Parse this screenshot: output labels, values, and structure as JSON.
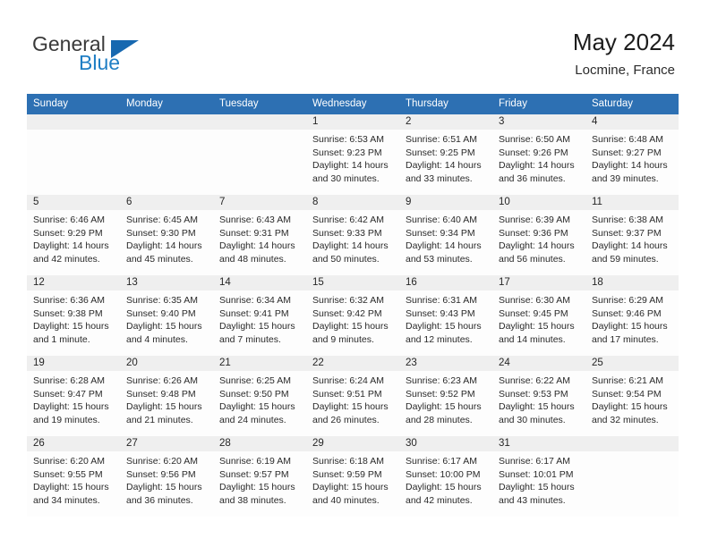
{
  "brand": {
    "name_part1": "General",
    "name_part2": "Blue"
  },
  "header": {
    "title": "May 2024",
    "location": "Locmine, France"
  },
  "colors": {
    "header_blue": "#2d70b3",
    "brand_blue": "#1f7ec4",
    "daynum_band": "#efefef",
    "text": "#2a2a2a"
  },
  "calendar": {
    "weekday_headers": [
      "Sunday",
      "Monday",
      "Tuesday",
      "Wednesday",
      "Thursday",
      "Friday",
      "Saturday"
    ],
    "weeks": [
      [
        {
          "day": "",
          "sunrise": "",
          "sunset": "",
          "daylight_1": "",
          "daylight_2": ""
        },
        {
          "day": "",
          "sunrise": "",
          "sunset": "",
          "daylight_1": "",
          "daylight_2": ""
        },
        {
          "day": "",
          "sunrise": "",
          "sunset": "",
          "daylight_1": "",
          "daylight_2": ""
        },
        {
          "day": "1",
          "sunrise": "Sunrise: 6:53 AM",
          "sunset": "Sunset: 9:23 PM",
          "daylight_1": "Daylight: 14 hours",
          "daylight_2": "and 30 minutes."
        },
        {
          "day": "2",
          "sunrise": "Sunrise: 6:51 AM",
          "sunset": "Sunset: 9:25 PM",
          "daylight_1": "Daylight: 14 hours",
          "daylight_2": "and 33 minutes."
        },
        {
          "day": "3",
          "sunrise": "Sunrise: 6:50 AM",
          "sunset": "Sunset: 9:26 PM",
          "daylight_1": "Daylight: 14 hours",
          "daylight_2": "and 36 minutes."
        },
        {
          "day": "4",
          "sunrise": "Sunrise: 6:48 AM",
          "sunset": "Sunset: 9:27 PM",
          "daylight_1": "Daylight: 14 hours",
          "daylight_2": "and 39 minutes."
        }
      ],
      [
        {
          "day": "5",
          "sunrise": "Sunrise: 6:46 AM",
          "sunset": "Sunset: 9:29 PM",
          "daylight_1": "Daylight: 14 hours",
          "daylight_2": "and 42 minutes."
        },
        {
          "day": "6",
          "sunrise": "Sunrise: 6:45 AM",
          "sunset": "Sunset: 9:30 PM",
          "daylight_1": "Daylight: 14 hours",
          "daylight_2": "and 45 minutes."
        },
        {
          "day": "7",
          "sunrise": "Sunrise: 6:43 AM",
          "sunset": "Sunset: 9:31 PM",
          "daylight_1": "Daylight: 14 hours",
          "daylight_2": "and 48 minutes."
        },
        {
          "day": "8",
          "sunrise": "Sunrise: 6:42 AM",
          "sunset": "Sunset: 9:33 PM",
          "daylight_1": "Daylight: 14 hours",
          "daylight_2": "and 50 minutes."
        },
        {
          "day": "9",
          "sunrise": "Sunrise: 6:40 AM",
          "sunset": "Sunset: 9:34 PM",
          "daylight_1": "Daylight: 14 hours",
          "daylight_2": "and 53 minutes."
        },
        {
          "day": "10",
          "sunrise": "Sunrise: 6:39 AM",
          "sunset": "Sunset: 9:36 PM",
          "daylight_1": "Daylight: 14 hours",
          "daylight_2": "and 56 minutes."
        },
        {
          "day": "11",
          "sunrise": "Sunrise: 6:38 AM",
          "sunset": "Sunset: 9:37 PM",
          "daylight_1": "Daylight: 14 hours",
          "daylight_2": "and 59 minutes."
        }
      ],
      [
        {
          "day": "12",
          "sunrise": "Sunrise: 6:36 AM",
          "sunset": "Sunset: 9:38 PM",
          "daylight_1": "Daylight: 15 hours",
          "daylight_2": "and 1 minute."
        },
        {
          "day": "13",
          "sunrise": "Sunrise: 6:35 AM",
          "sunset": "Sunset: 9:40 PM",
          "daylight_1": "Daylight: 15 hours",
          "daylight_2": "and 4 minutes."
        },
        {
          "day": "14",
          "sunrise": "Sunrise: 6:34 AM",
          "sunset": "Sunset: 9:41 PM",
          "daylight_1": "Daylight: 15 hours",
          "daylight_2": "and 7 minutes."
        },
        {
          "day": "15",
          "sunrise": "Sunrise: 6:32 AM",
          "sunset": "Sunset: 9:42 PM",
          "daylight_1": "Daylight: 15 hours",
          "daylight_2": "and 9 minutes."
        },
        {
          "day": "16",
          "sunrise": "Sunrise: 6:31 AM",
          "sunset": "Sunset: 9:43 PM",
          "daylight_1": "Daylight: 15 hours",
          "daylight_2": "and 12 minutes."
        },
        {
          "day": "17",
          "sunrise": "Sunrise: 6:30 AM",
          "sunset": "Sunset: 9:45 PM",
          "daylight_1": "Daylight: 15 hours",
          "daylight_2": "and 14 minutes."
        },
        {
          "day": "18",
          "sunrise": "Sunrise: 6:29 AM",
          "sunset": "Sunset: 9:46 PM",
          "daylight_1": "Daylight: 15 hours",
          "daylight_2": "and 17 minutes."
        }
      ],
      [
        {
          "day": "19",
          "sunrise": "Sunrise: 6:28 AM",
          "sunset": "Sunset: 9:47 PM",
          "daylight_1": "Daylight: 15 hours",
          "daylight_2": "and 19 minutes."
        },
        {
          "day": "20",
          "sunrise": "Sunrise: 6:26 AM",
          "sunset": "Sunset: 9:48 PM",
          "daylight_1": "Daylight: 15 hours",
          "daylight_2": "and 21 minutes."
        },
        {
          "day": "21",
          "sunrise": "Sunrise: 6:25 AM",
          "sunset": "Sunset: 9:50 PM",
          "daylight_1": "Daylight: 15 hours",
          "daylight_2": "and 24 minutes."
        },
        {
          "day": "22",
          "sunrise": "Sunrise: 6:24 AM",
          "sunset": "Sunset: 9:51 PM",
          "daylight_1": "Daylight: 15 hours",
          "daylight_2": "and 26 minutes."
        },
        {
          "day": "23",
          "sunrise": "Sunrise: 6:23 AM",
          "sunset": "Sunset: 9:52 PM",
          "daylight_1": "Daylight: 15 hours",
          "daylight_2": "and 28 minutes."
        },
        {
          "day": "24",
          "sunrise": "Sunrise: 6:22 AM",
          "sunset": "Sunset: 9:53 PM",
          "daylight_1": "Daylight: 15 hours",
          "daylight_2": "and 30 minutes."
        },
        {
          "day": "25",
          "sunrise": "Sunrise: 6:21 AM",
          "sunset": "Sunset: 9:54 PM",
          "daylight_1": "Daylight: 15 hours",
          "daylight_2": "and 32 minutes."
        }
      ],
      [
        {
          "day": "26",
          "sunrise": "Sunrise: 6:20 AM",
          "sunset": "Sunset: 9:55 PM",
          "daylight_1": "Daylight: 15 hours",
          "daylight_2": "and 34 minutes."
        },
        {
          "day": "27",
          "sunrise": "Sunrise: 6:20 AM",
          "sunset": "Sunset: 9:56 PM",
          "daylight_1": "Daylight: 15 hours",
          "daylight_2": "and 36 minutes."
        },
        {
          "day": "28",
          "sunrise": "Sunrise: 6:19 AM",
          "sunset": "Sunset: 9:57 PM",
          "daylight_1": "Daylight: 15 hours",
          "daylight_2": "and 38 minutes."
        },
        {
          "day": "29",
          "sunrise": "Sunrise: 6:18 AM",
          "sunset": "Sunset: 9:59 PM",
          "daylight_1": "Daylight: 15 hours",
          "daylight_2": "and 40 minutes."
        },
        {
          "day": "30",
          "sunrise": "Sunrise: 6:17 AM",
          "sunset": "Sunset: 10:00 PM",
          "daylight_1": "Daylight: 15 hours",
          "daylight_2": "and 42 minutes."
        },
        {
          "day": "31",
          "sunrise": "Sunrise: 6:17 AM",
          "sunset": "Sunset: 10:01 PM",
          "daylight_1": "Daylight: 15 hours",
          "daylight_2": "and 43 minutes."
        },
        {
          "day": "",
          "sunrise": "",
          "sunset": "",
          "daylight_1": "",
          "daylight_2": ""
        }
      ]
    ]
  }
}
